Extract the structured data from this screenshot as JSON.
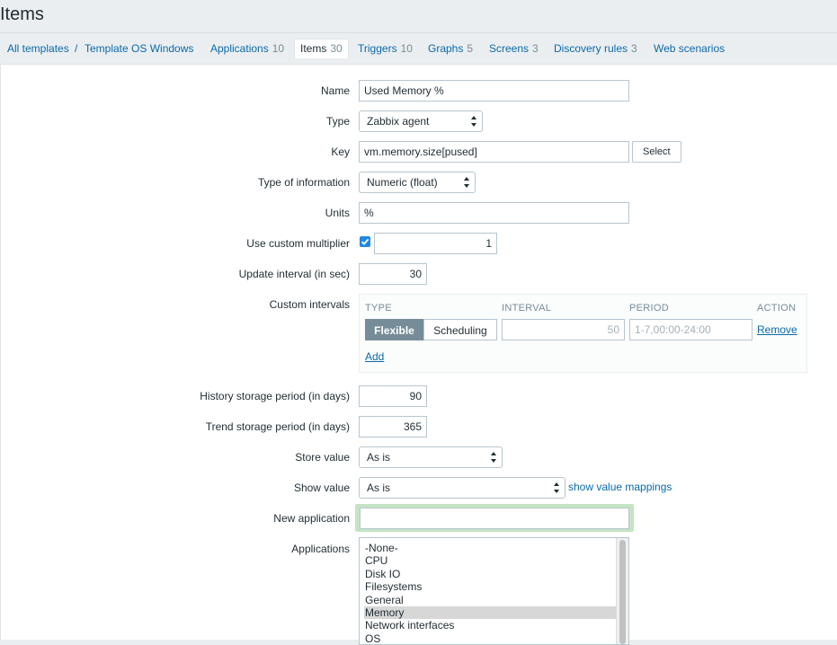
{
  "page_title": "Items",
  "breadcrumb": {
    "all_templates": "All templates",
    "separator": "/",
    "template": "Template OS Windows"
  },
  "tabs": [
    {
      "label": "Applications",
      "count": "10"
    },
    {
      "label": "Items",
      "count": "30"
    },
    {
      "label": "Triggers",
      "count": "10"
    },
    {
      "label": "Graphs",
      "count": "5"
    },
    {
      "label": "Screens",
      "count": "3"
    },
    {
      "label": "Discovery rules",
      "count": "3"
    },
    {
      "label": "Web scenarios",
      "count": ""
    }
  ],
  "form": {
    "name_label": "Name",
    "name_value": "Used Memory %",
    "type_label": "Type",
    "type_value": "Zabbix agent",
    "key_label": "Key",
    "key_value": "vm.memory.size[pused]",
    "key_select_button": "Select",
    "type_info_label": "Type of information",
    "type_info_value": "Numeric (float)",
    "units_label": "Units",
    "units_value": "%",
    "multiplier_label": "Use custom multiplier",
    "multiplier_checked": true,
    "multiplier_value": "1",
    "update_interval_label": "Update interval (in sec)",
    "update_interval_value": "30",
    "custom_intervals_label": "Custom intervals",
    "custom_intervals": {
      "col_type": "TYPE",
      "col_interval": "INTERVAL",
      "col_period": "PERIOD",
      "col_action": "ACTION",
      "flexible": "Flexible",
      "scheduling": "Scheduling",
      "interval_value": "50",
      "period_placeholder": "1-7,00:00-24:00",
      "remove": "Remove",
      "add": "Add"
    },
    "history_label": "History storage period (in days)",
    "history_value": "90",
    "trend_label": "Trend storage period (in days)",
    "trend_value": "365",
    "store_value_label": "Store value",
    "store_value": "As is",
    "show_value_label": "Show value",
    "show_value": "As is",
    "show_value_mappings": "show value mappings",
    "new_application_label": "New application",
    "new_application_value": "",
    "applications_label": "Applications",
    "applications": [
      {
        "label": "-None-",
        "selected": false
      },
      {
        "label": "CPU",
        "selected": false
      },
      {
        "label": "Disk IO",
        "selected": false
      },
      {
        "label": "Filesystems",
        "selected": false
      },
      {
        "label": "General",
        "selected": false
      },
      {
        "label": "Memory",
        "selected": true
      },
      {
        "label": "Network interfaces",
        "selected": false
      },
      {
        "label": "OS",
        "selected": false
      }
    ]
  },
  "colors": {
    "link": "#0a6aa8",
    "checkbox": "#1e87e3",
    "segment_active": "#768d99",
    "new_app_highlight": "#c4e4c4"
  }
}
